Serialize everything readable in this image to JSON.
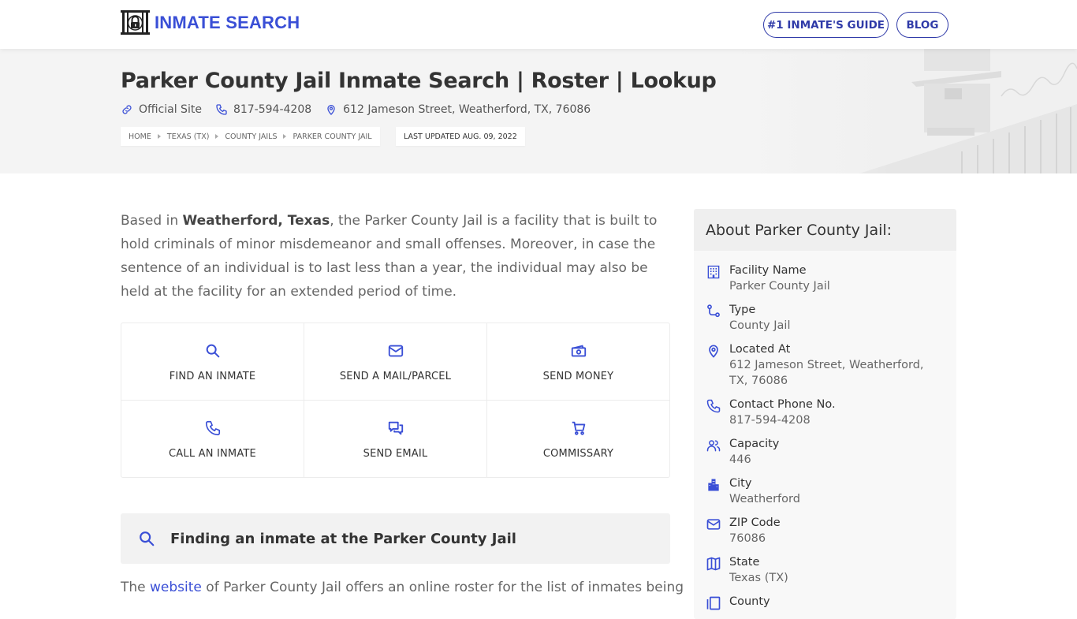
{
  "header": {
    "logo_text": "INMATE SEARCH",
    "nav": [
      {
        "label": "#1 INMATE'S GUIDE"
      },
      {
        "label": "BLOG"
      }
    ]
  },
  "hero": {
    "title": "Parker County Jail Inmate Search | Roster | Lookup",
    "official_site": "Official Site",
    "phone": "817-594-4208",
    "address": "612 Jameson Street, Weatherford, TX, 76086",
    "breadcrumbs": [
      "HOME",
      "TEXAS (TX)",
      "COUNTY JAILS",
      "PARKER COUNTY JAIL"
    ],
    "last_updated": "LAST UPDATED AUG. 09, 2022"
  },
  "intro": {
    "prefix": "Based in ",
    "bold": "Weatherford, Texas",
    "suffix": ", the Parker County Jail is a facility that is built to hold criminals of minor misdemeanor and small offenses. Moreover, in case the sentence of an individual is to last less than a year, the individual may also be held at the facility for an extended period of time."
  },
  "actions": [
    {
      "label": "FIND AN INMATE",
      "icon": "search-icon"
    },
    {
      "label": "SEND A MAIL/PARCEL",
      "icon": "mail-icon"
    },
    {
      "label": "SEND MONEY",
      "icon": "money-icon"
    },
    {
      "label": "CALL AN INMATE",
      "icon": "phone-icon"
    },
    {
      "label": "SEND EMAIL",
      "icon": "chat-icon"
    },
    {
      "label": "COMMISSARY",
      "icon": "cart-icon"
    }
  ],
  "section": {
    "title": "Finding an inmate at the Parker County Jail",
    "text_prefix": "The ",
    "link": "website",
    "text_suffix": " of Parker County Jail offers an online roster for the list of inmates being"
  },
  "sidebar": {
    "title": "About Parker County Jail:",
    "items": [
      {
        "label": "Facility Name",
        "value": "Parker County Jail",
        "icon": "building-icon"
      },
      {
        "label": "Type",
        "value": "County Jail",
        "icon": "route-icon"
      },
      {
        "label": "Located At",
        "value": "612 Jameson Street, Weatherford, TX, 76086",
        "icon": "location-pin-icon"
      },
      {
        "label": "Contact Phone No.",
        "value": "817-594-4208",
        "icon": "phone-icon"
      },
      {
        "label": "Capacity",
        "value": "446",
        "icon": "users-icon"
      },
      {
        "label": "City",
        "value": "Weatherford",
        "icon": "city-icon"
      },
      {
        "label": "ZIP Code",
        "value": "76086",
        "icon": "mail-icon"
      },
      {
        "label": "State",
        "value": "Texas (TX)",
        "icon": "map-icon"
      },
      {
        "label": "County",
        "value": "",
        "icon": "book-icon"
      }
    ]
  },
  "colors": {
    "accent": "#3a4fd6",
    "nav_border": "#2f3aa8",
    "hero_bg": "#f4f4f4",
    "sidebar_bg": "#f8f8f8"
  }
}
